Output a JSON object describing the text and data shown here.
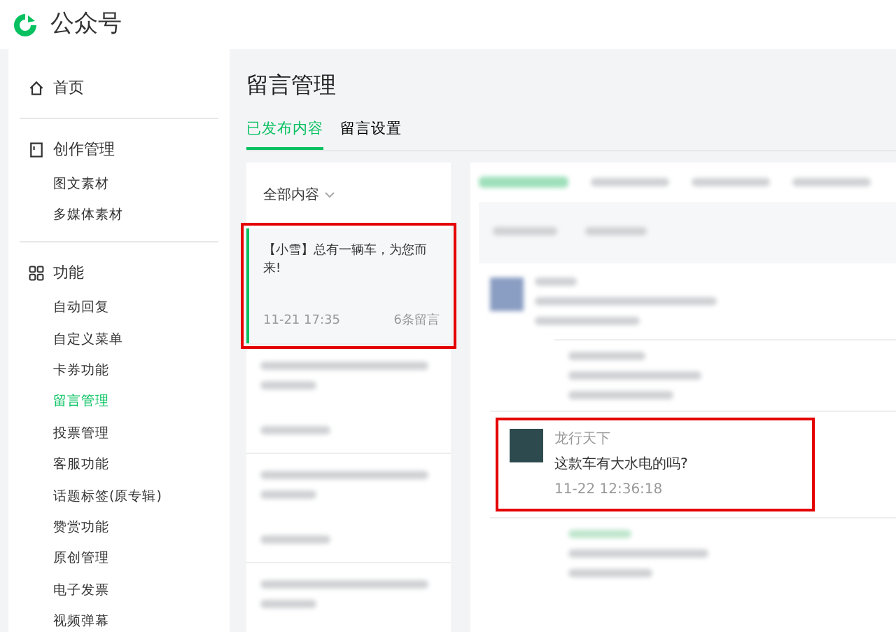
{
  "app": {
    "title": "公众号"
  },
  "sidebar": {
    "sections": [
      {
        "label": "首页",
        "kind": "home"
      },
      {
        "label": "创作管理",
        "kind": "doc",
        "items": [
          {
            "label": "图文素材",
            "selected": false
          },
          {
            "label": "多媒体素材",
            "selected": false
          }
        ]
      },
      {
        "label": "功能",
        "kind": "grid",
        "items": [
          {
            "label": "自动回复",
            "selected": false
          },
          {
            "label": "自定义菜单",
            "selected": false
          },
          {
            "label": "卡券功能",
            "selected": false
          },
          {
            "label": "留言管理",
            "selected": true
          },
          {
            "label": "投票管理",
            "selected": false
          },
          {
            "label": "客服功能",
            "selected": false
          },
          {
            "label": "话题标签(原专辑)",
            "selected": false
          },
          {
            "label": "赞赏功能",
            "selected": false
          },
          {
            "label": "原创管理",
            "selected": false
          },
          {
            "label": "电子发票",
            "selected": false
          },
          {
            "label": "视频弹幕",
            "selected": false
          }
        ]
      }
    ]
  },
  "page": {
    "title": "留言管理",
    "tabs": [
      {
        "label": "已发布内容",
        "selected": true
      },
      {
        "label": "留言设置",
        "selected": false
      }
    ],
    "filter": "全部内容",
    "articles": [
      {
        "title": "【小雪】总有一辆车，为您而来!",
        "date": "11-21 17:35",
        "count": "6条留言",
        "selected": true,
        "highlighted": true
      }
    ],
    "comment": {
      "author": "龙行天下",
      "text": "这款车有大水电的吗?",
      "time": "11-22 12:36:18",
      "highlighted": true
    }
  }
}
